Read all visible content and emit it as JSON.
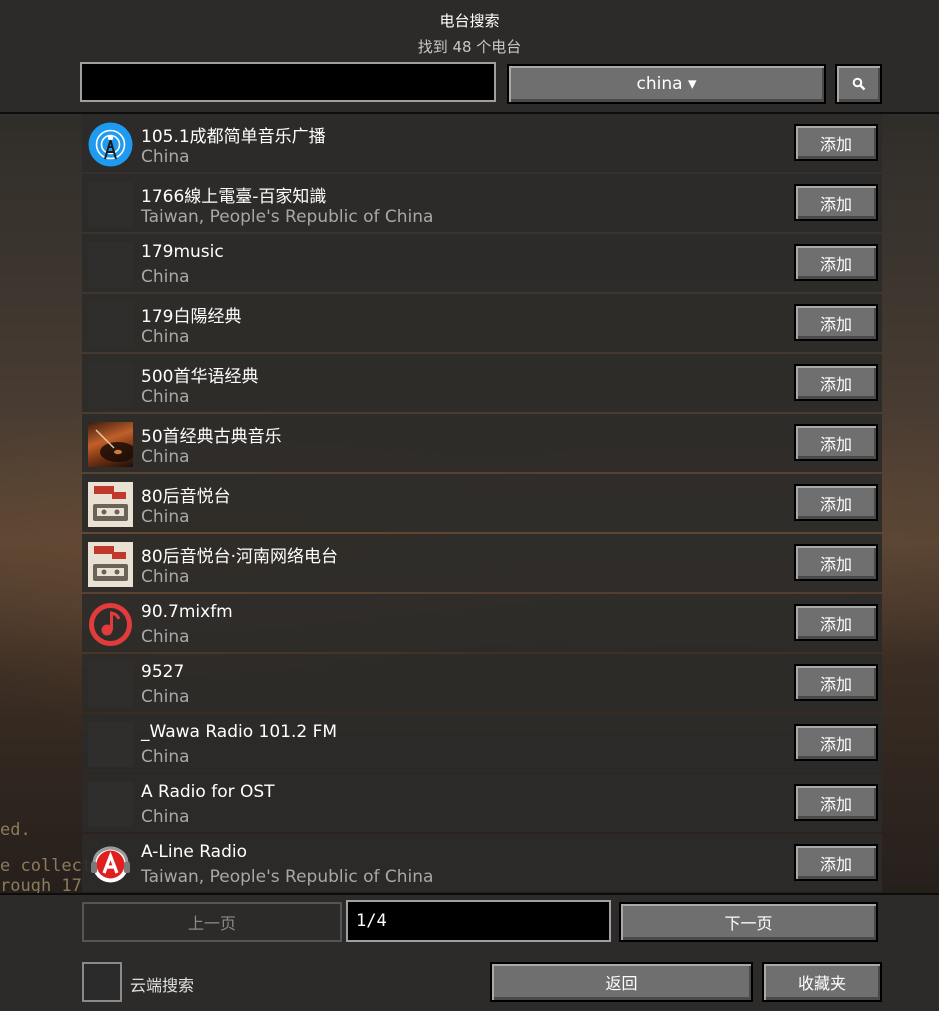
{
  "header": {
    "title": "电台搜索",
    "subtitle": "找到 48 个电台",
    "search_value": "",
    "country_filter": "china ▾",
    "search_icon": "search-icon"
  },
  "background_text": {
    "line1": "ed.",
    "line2": "e collect",
    "line3": "rough 17"
  },
  "stations": [
    {
      "name": "105.1成都简单音乐广播",
      "country": "China",
      "icon": "radio-tower-icon"
    },
    {
      "name": "1766線上電臺-百家知識",
      "country": "Taiwan, People's Republic of China",
      "icon": "blank"
    },
    {
      "name": "179music",
      "country": "China",
      "icon": "blank"
    },
    {
      "name": "179白陽经典",
      "country": "China",
      "icon": "blank"
    },
    {
      "name": "500首华语经典",
      "country": "China",
      "icon": "blank"
    },
    {
      "name": "50首经典古典音乐",
      "country": "China",
      "icon": "vinyl-record-photo"
    },
    {
      "name": "80后音悦台",
      "country": "China",
      "icon": "cassette-logo"
    },
    {
      "name": "80后音悦台·河南网络电台",
      "country": "China",
      "icon": "cassette-logo"
    },
    {
      "name": "90.7mixfm",
      "country": "China",
      "icon": "music-note-circle-icon"
    },
    {
      "name": "9527",
      "country": "China",
      "icon": "blank"
    },
    {
      "name": "_Wawa Radio 101.2 FM",
      "country": "China",
      "icon": "blank"
    },
    {
      "name": "A Radio for OST",
      "country": "China",
      "icon": "blank"
    },
    {
      "name": "A-Line Radio",
      "country": "Taiwan, People's Republic of China",
      "icon": "a-line-logo"
    }
  ],
  "add_label": "添加",
  "pagination": {
    "prev_label": "上一页",
    "page_value": "1/4",
    "next_label": "下一页"
  },
  "footer": {
    "cloud_search_label": "云端搜索",
    "back_label": "返回",
    "favorites_label": "收藏夹"
  },
  "colors": {
    "panel": "#2c2b29",
    "button": "#6f6f6f",
    "subtext": "#a8a8a8",
    "accent_blue": "#1e9bf0",
    "accent_red": "#e23b3b"
  }
}
